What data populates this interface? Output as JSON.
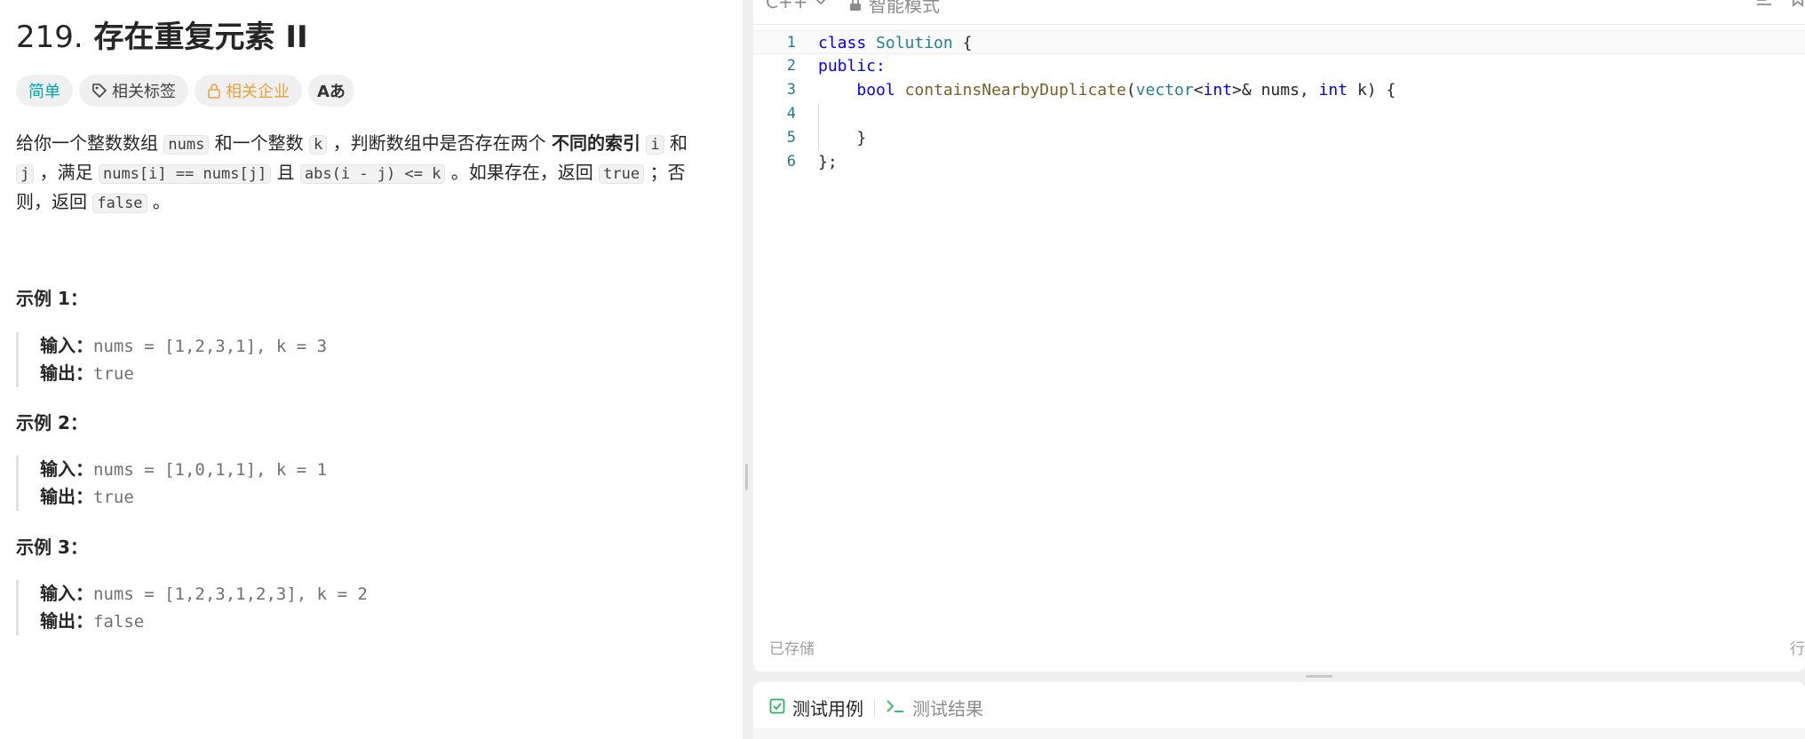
{
  "problem": {
    "number": "219.",
    "name": "存在重复元素 II",
    "tags": {
      "difficulty": "简单",
      "related_tags": "相关标签",
      "companies": "相关企业",
      "lang_toggle": "Aあ"
    },
    "desc": {
      "t1": "给你一个整数数组 ",
      "c1": "nums",
      "t2": " 和一个整数 ",
      "c2": "k",
      "t3": " ，判断数组中是否存在两个 ",
      "b1": "不同的索引",
      "t4": " ",
      "c3": "i",
      "t5": " 和 ",
      "c4": "j",
      "t6": " ，满足 ",
      "c5": "nums[i] == nums[j]",
      "t7": " 且 ",
      "c6": "abs(i - j) <= k",
      "t8": " 。如果存在，返回 ",
      "c7": "true",
      "t9": " ；否则，返回 ",
      "c8": "false",
      "t10": " 。"
    },
    "examples": [
      {
        "title": "示例 1：",
        "input_label": "输入：",
        "input": "nums = [1,2,3,1], k = 3",
        "output_label": "输出：",
        "output": "true"
      },
      {
        "title": "示例 2：",
        "input_label": "输入：",
        "input": "nums = [1,0,1,1], k = 1",
        "output_label": "输出：",
        "output": "true"
      },
      {
        "title": "示例 3：",
        "input_label": "输入：",
        "input": "nums = [1,2,3,1,2,3], k = 2",
        "output_label": "输出：",
        "output": "false"
      }
    ]
  },
  "editor": {
    "language": "C++",
    "mode": "智能模式",
    "saved": "已存储",
    "row_col": "行",
    "lines": [
      {
        "n": "1",
        "tokens": [
          [
            "kw",
            "class"
          ],
          [
            "",
            "",
            " "
          ],
          [
            "ty",
            "Solution"
          ],
          [
            "",
            " {"
          ]
        ]
      },
      {
        "n": "2",
        "tokens": [
          [
            "kw",
            "public:"
          ]
        ]
      },
      {
        "n": "3",
        "tokens": [
          [
            "",
            "    "
          ],
          [
            "kw",
            "bool"
          ],
          [
            "",
            " "
          ],
          [
            "fn",
            "containsNearbyDuplicate"
          ],
          [
            "",
            "("
          ],
          [
            "ty",
            "vector"
          ],
          [
            "",
            "<"
          ],
          [
            "kw",
            "int"
          ],
          [
            "",
            "&gt;"
          ],
          [
            "",
            "&amp; nums, "
          ],
          [
            "kw",
            "int"
          ],
          [
            "",
            " k) {"
          ]
        ]
      },
      {
        "n": "4",
        "tokens": []
      },
      {
        "n": "5",
        "tokens": [
          [
            "",
            "    }"
          ]
        ]
      },
      {
        "n": "6",
        "tokens": [
          [
            "",
            "};"
          ]
        ]
      }
    ]
  },
  "tests": {
    "tab_cases": "测试用例",
    "tab_result": "测试结果"
  },
  "colors": {
    "easy": "#00a8a8",
    "company": "#e6a23c",
    "keyword": "#0000ff",
    "type": "#267f99",
    "function": "#795e26",
    "check": "#2db55d"
  }
}
